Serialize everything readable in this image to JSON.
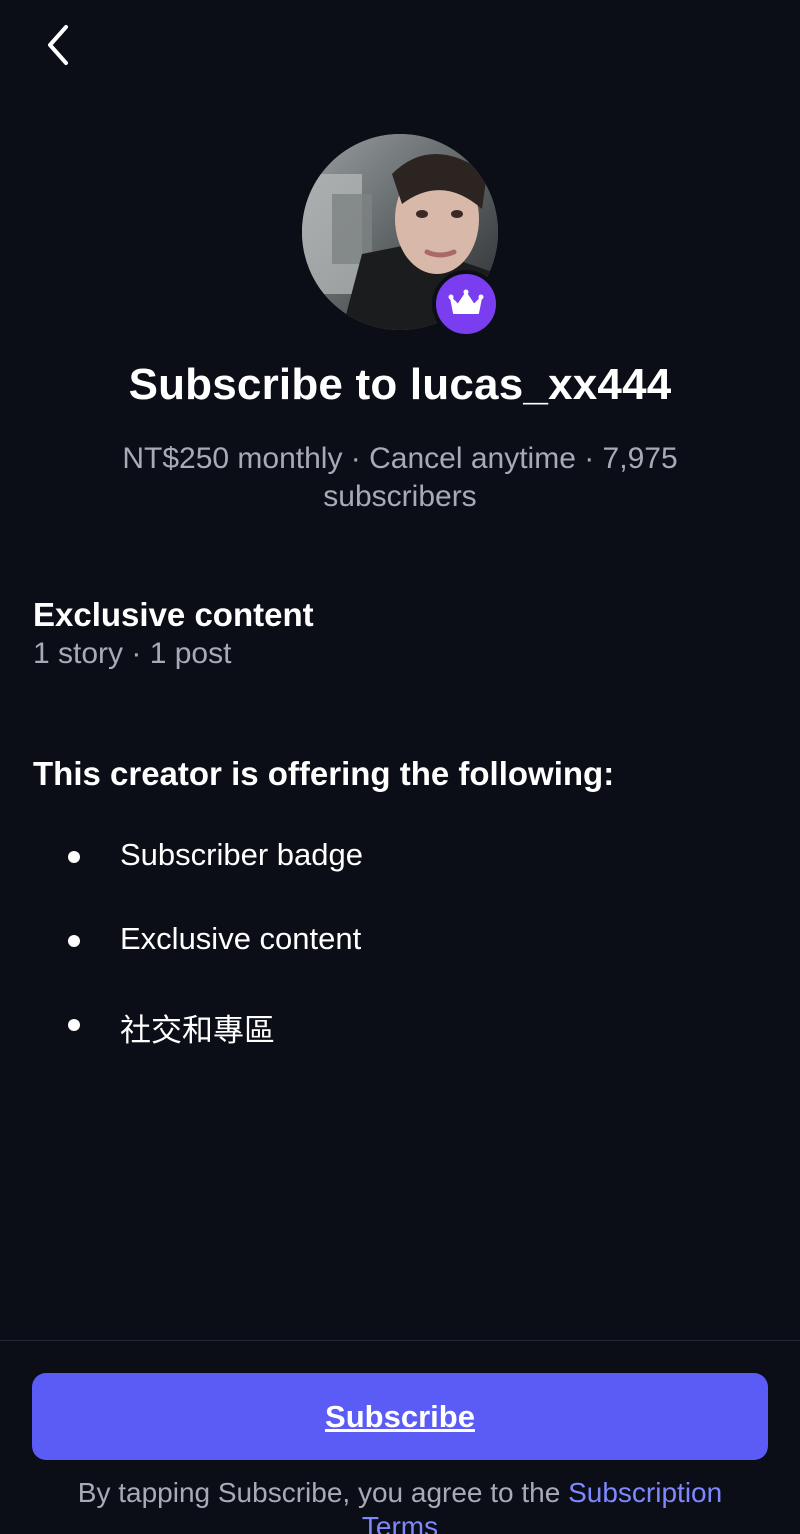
{
  "header": {
    "back_icon": "chevron-left-icon"
  },
  "profile": {
    "avatar_description": "creator-avatar",
    "badge_icon": "crown-icon",
    "badge_color": "#7b3df0"
  },
  "title": "Subscribe to lucas_xx444",
  "subtitle": "NT$250 monthly · Cancel anytime · 7,975 subscribers",
  "exclusive": {
    "heading": "Exclusive content",
    "detail": "1 story · 1 post"
  },
  "offering": {
    "heading": "This creator is offering the following:",
    "items": [
      {
        "label": "Subscriber badge"
      },
      {
        "label": "Exclusive content"
      },
      {
        "label": "社交和專區"
      }
    ]
  },
  "footer": {
    "subscribe_label": "Subscribe",
    "button_color": "#5b5cf6",
    "terms_prefix": "By tapping Subscribe, you agree to the ",
    "terms_link": "Subscription Terms"
  }
}
